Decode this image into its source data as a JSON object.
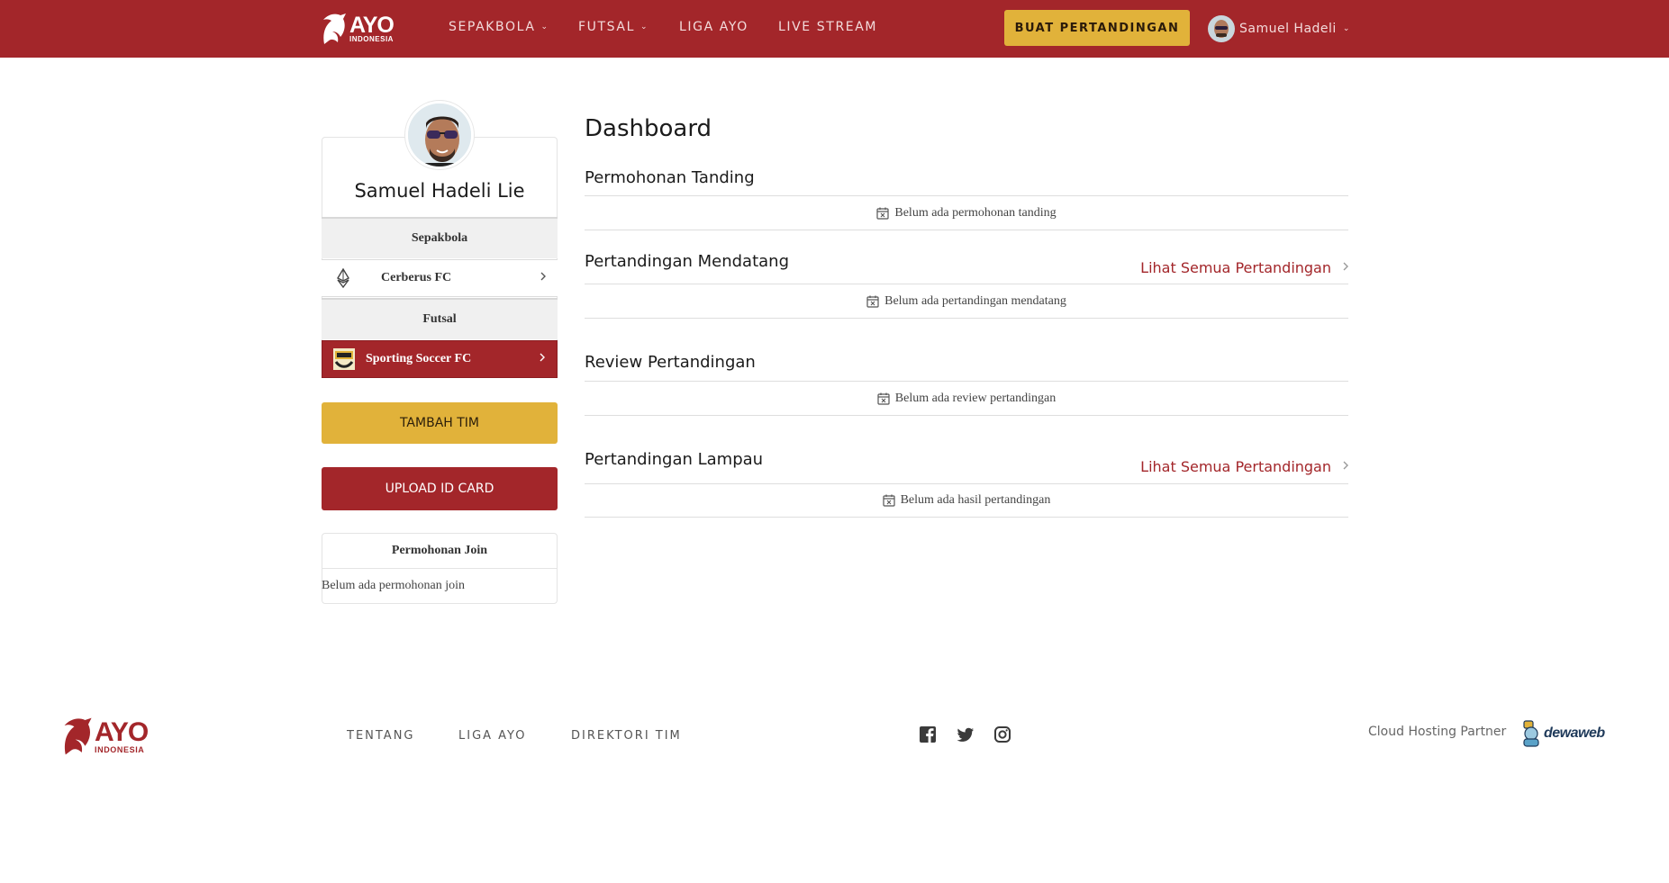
{
  "navbar": {
    "logo_text": "AYO",
    "logo_sub": "INDONESIA",
    "menu": [
      {
        "label": "SEPAKBOLA",
        "dropdown": true
      },
      {
        "label": "FUTSAL",
        "dropdown": true
      },
      {
        "label": "LIGA AYO",
        "dropdown": false
      },
      {
        "label": "LIVE STREAM",
        "dropdown": false
      }
    ],
    "cta_label": "BUAT PERTANDINGAN",
    "user_name": "Samuel Hadeli",
    "chevron": "⌄"
  },
  "profile": {
    "name": "Samuel Hadeli Lie",
    "categories": [
      {
        "label": "Sepakbola",
        "team": "Cerberus FC",
        "team_icon": "ethereum-diamond-icon"
      },
      {
        "label": "Futsal",
        "team": "Sporting Soccer FC",
        "team_icon": "ssfc-badge-icon",
        "active": true
      }
    ],
    "add_team_label": "TAMBAH TIM",
    "upload_id_label": "UPLOAD ID CARD",
    "join_title": "Permohonan Join",
    "join_empty": "Belum ada permohonan join"
  },
  "dashboard": {
    "title": "Dashboard",
    "sections": [
      {
        "title": "Permohonan Tanding",
        "empty": "Belum ada permohonan tanding",
        "link": null
      },
      {
        "title": "Pertandingan Mendatang",
        "empty": "Belum ada pertandingan mendatang",
        "link": "Lihat Semua Pertandingan"
      },
      {
        "title": "Review Pertandingan",
        "empty": "Belum ada review pertandingan",
        "link": null
      },
      {
        "title": "Pertandingan Lampau",
        "empty": "Belum ada hasil pertandingan",
        "link": "Lihat Semua Pertandingan"
      }
    ]
  },
  "footer": {
    "logo_text": "AYO",
    "logo_sub": "INDONESIA",
    "links": [
      "TENTANG",
      "LIGA AYO",
      "DIREKTORI TIM"
    ],
    "social": [
      "facebook-icon",
      "twitter-icon",
      "instagram-icon"
    ],
    "partner_label": "Cloud Hosting Partner",
    "partner_name": "dewaweb"
  },
  "colors": {
    "brand_red": "#a3262a",
    "accent_yellow": "#e1b23a"
  }
}
